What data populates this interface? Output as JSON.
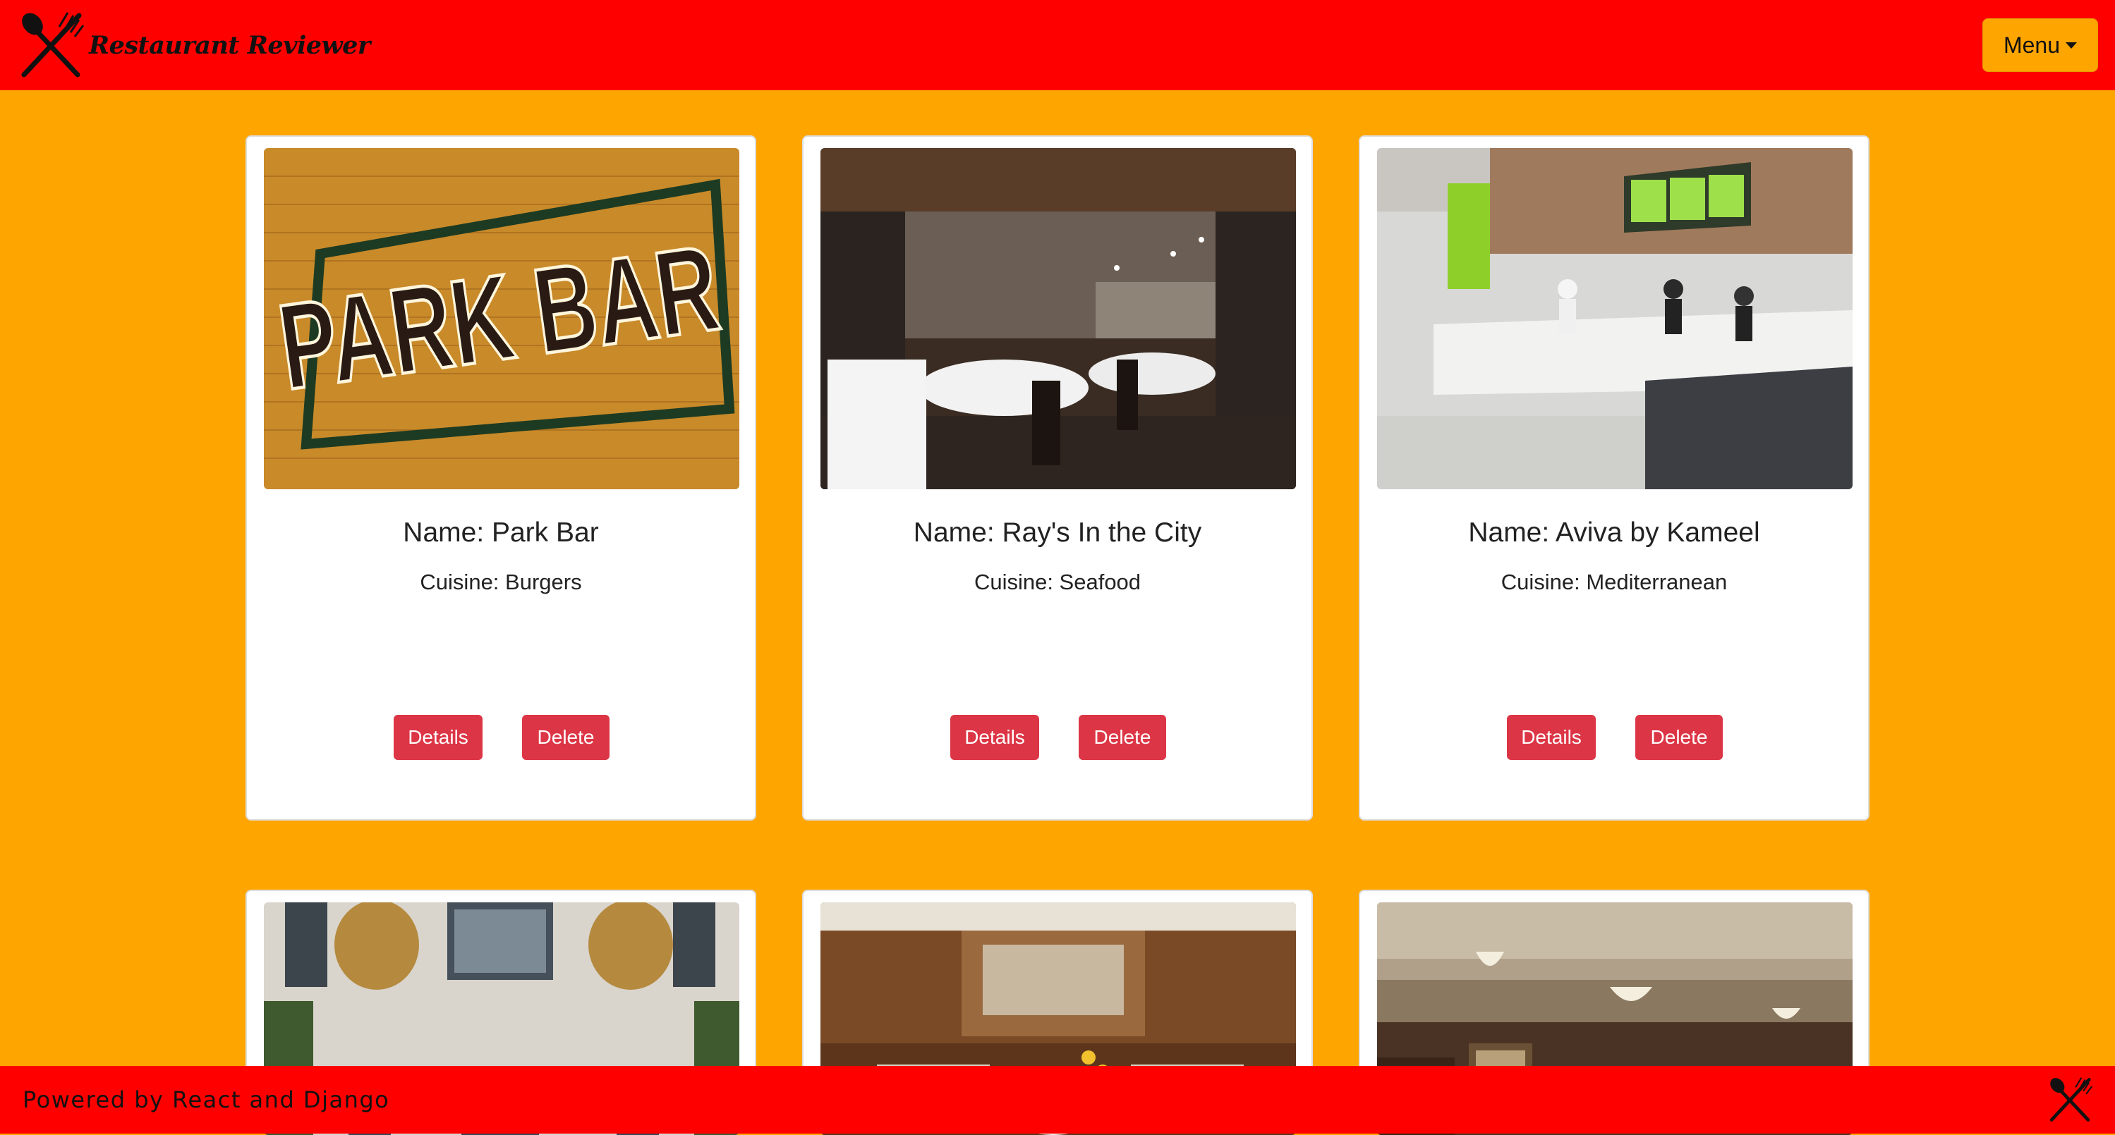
{
  "header": {
    "brand": "Restaurant Reviewer",
    "brand_icon": "fork-knife-icon",
    "menu_label": "Menu"
  },
  "restaurants": [
    {
      "name": "Name: Park Bar",
      "cuisine": "Cuisine: Burgers",
      "details_label": "Details",
      "delete_label": "Delete",
      "image": "park-bar-sign-photo"
    },
    {
      "name": "Name: Ray's In the City",
      "cuisine": "Cuisine: Seafood",
      "details_label": "Details",
      "delete_label": "Delete",
      "image": "dining-room-photo"
    },
    {
      "name": "Name: Aviva by Kameel",
      "cuisine": "Cuisine: Mediterranean",
      "details_label": "Details",
      "delete_label": "Delete",
      "image": "counter-kitchen-photo"
    },
    {
      "image": "atrium-chandeliers-photo"
    },
    {
      "image": "wood-interior-photo"
    },
    {
      "image": "restaurant-ceiling-lights-photo"
    }
  ],
  "footer": {
    "text": "Powered by React and Django",
    "icon": "fork-knife-icon"
  },
  "colors": {
    "background": "#ffa500",
    "bar": "#ff0000",
    "button": "#dc3545",
    "card": "#ffffff"
  }
}
